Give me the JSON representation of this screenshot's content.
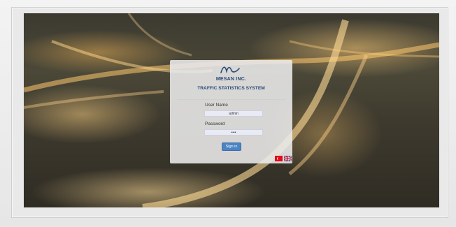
{
  "login": {
    "company_name": "MESAN INC.",
    "system_name": "TRAFFIC STATISTICS SYSTEM",
    "username_label": "User Name",
    "username_value": "admin",
    "password_label": "Password",
    "password_value": "••••",
    "signin_label": "Sign in"
  },
  "languages": [
    {
      "code": "tr",
      "icon": "turkish-flag-icon"
    },
    {
      "code": "en",
      "icon": "uk-flag-icon"
    }
  ],
  "colors": {
    "brand_text": "#2a4a7a",
    "signin_button": "#4a84c4",
    "input_background": "#e8ebf5"
  }
}
